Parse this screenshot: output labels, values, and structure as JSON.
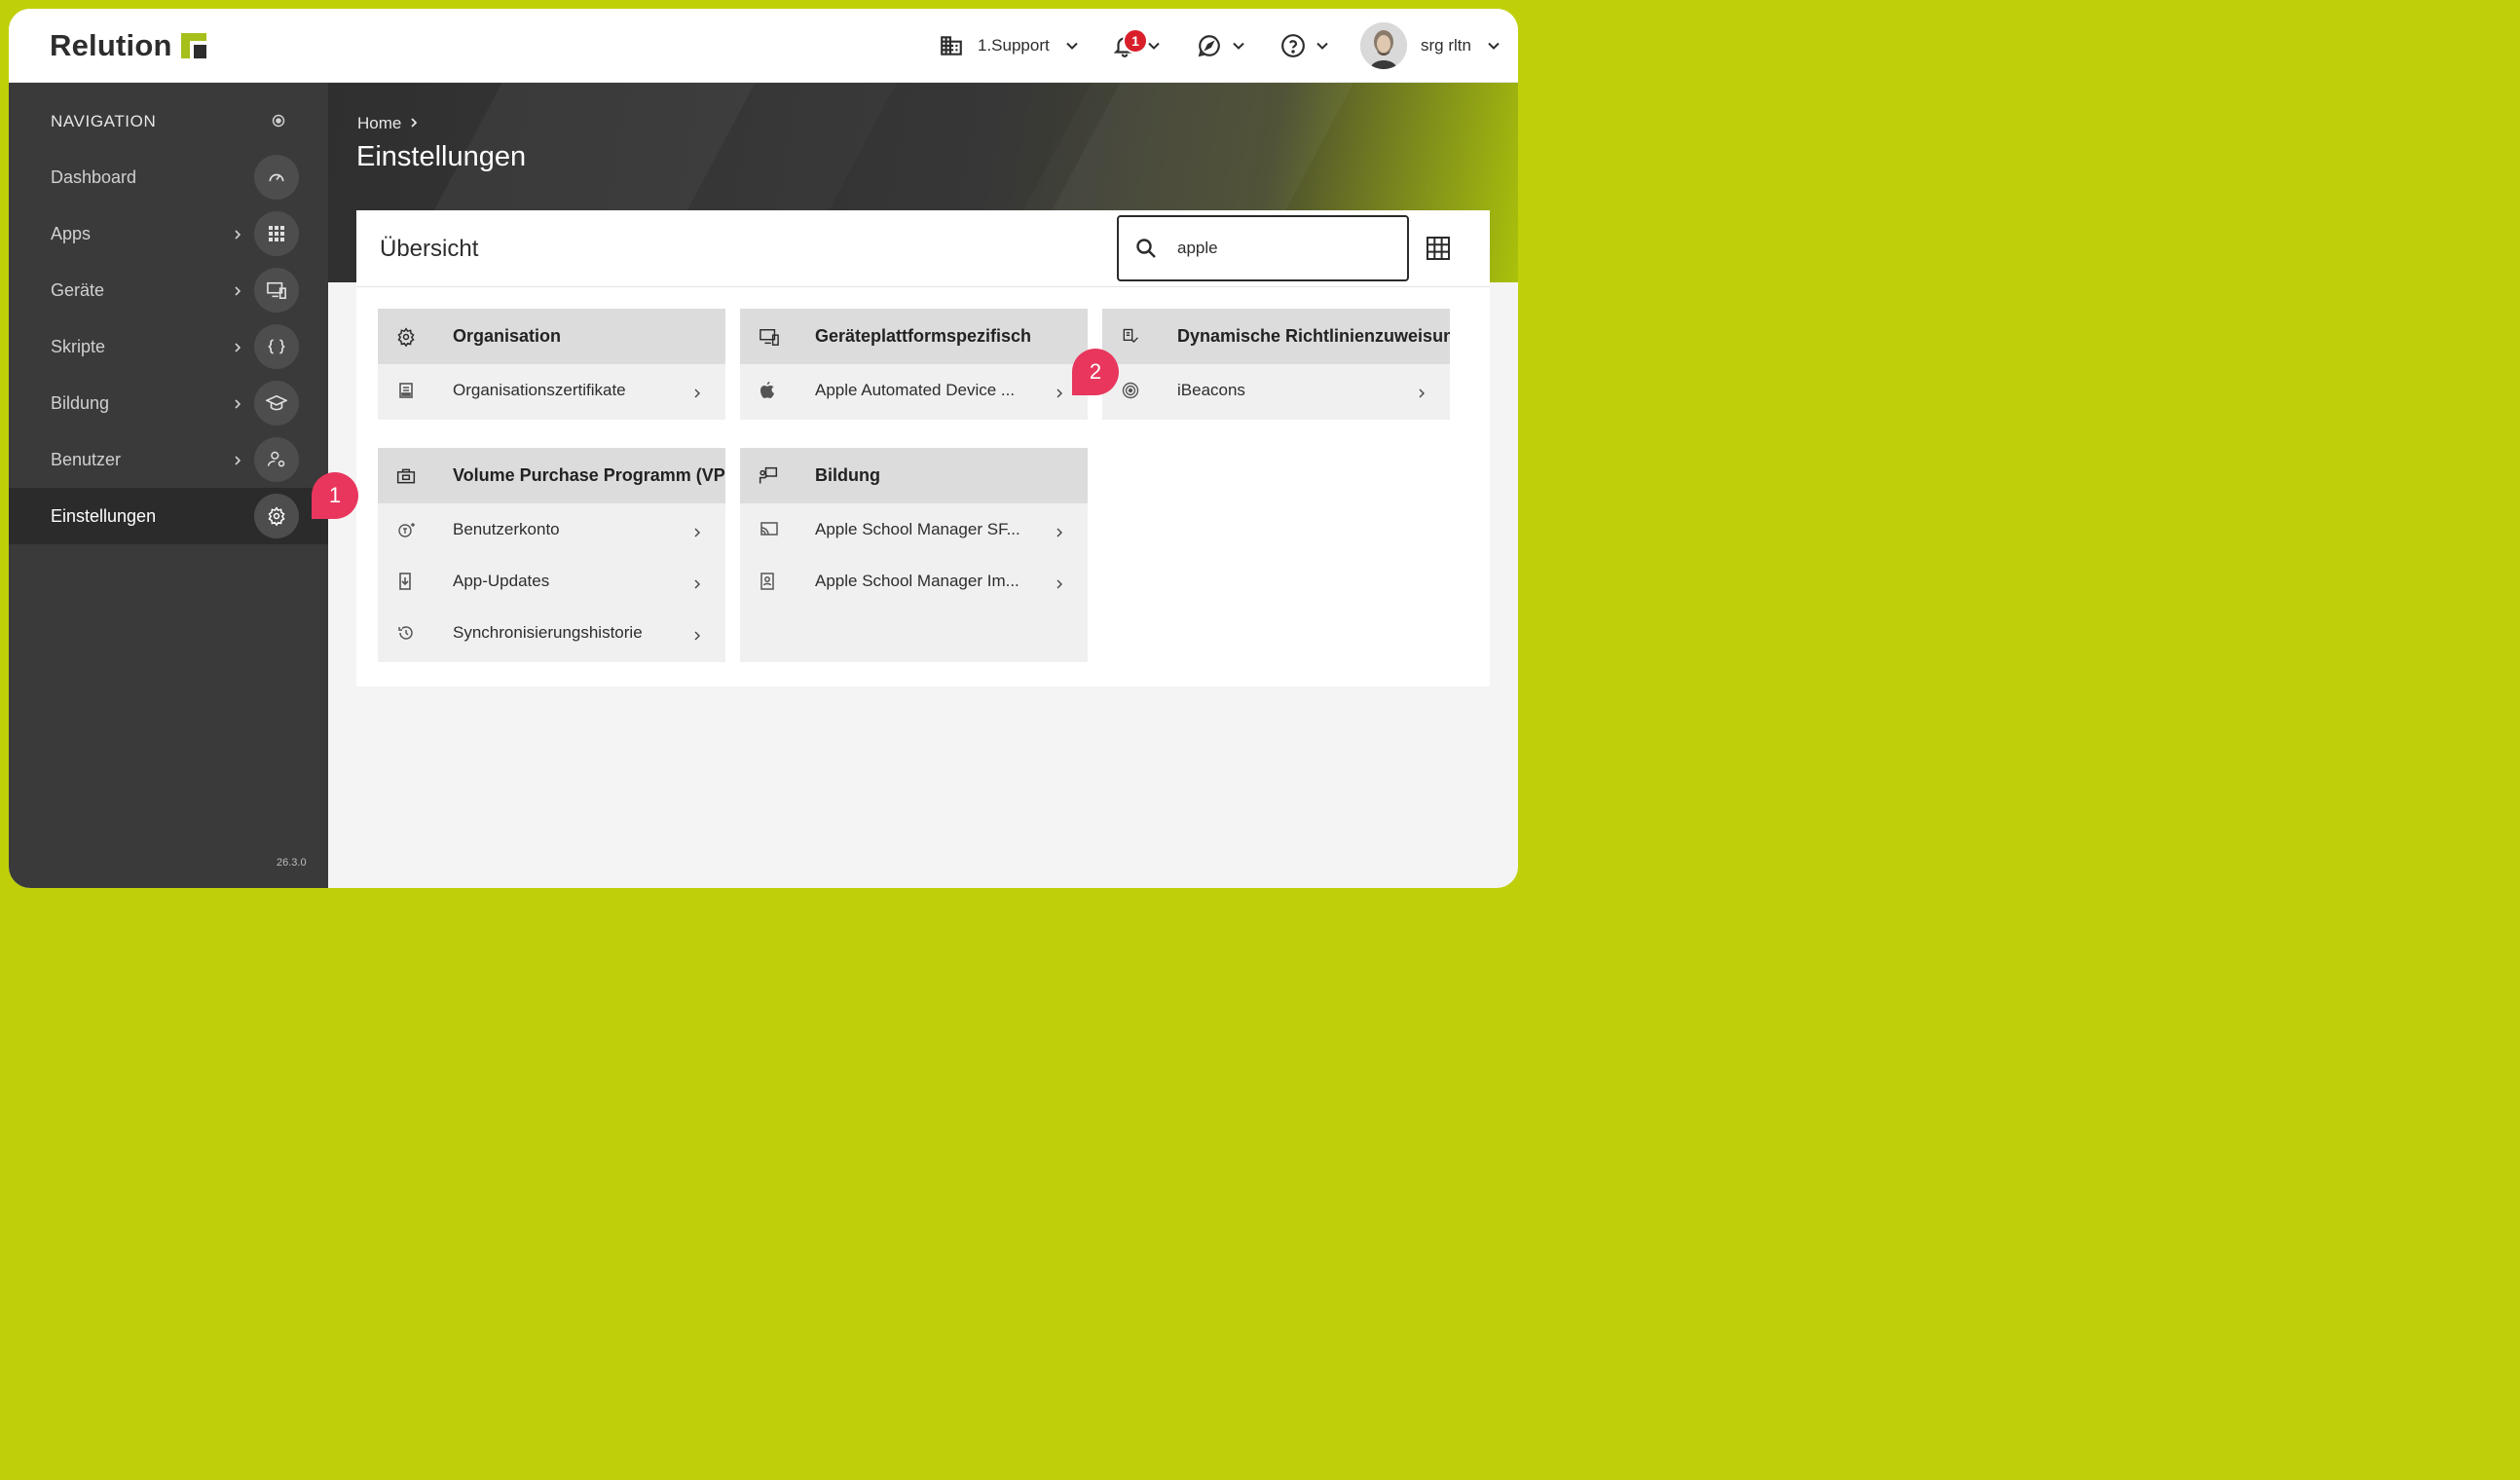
{
  "app": {
    "name": "Relution",
    "version": "26.3.0"
  },
  "topbar": {
    "organization": "1.Support",
    "notification_count": "1",
    "user_name": "srg rltn"
  },
  "navigation": {
    "heading": "NAVIGATION",
    "items": [
      {
        "label": "Dashboard",
        "icon": "speedometer-icon",
        "has_submenu": false,
        "active": false
      },
      {
        "label": "Apps",
        "icon": "apps-grid-icon",
        "has_submenu": true,
        "active": false
      },
      {
        "label": "Geräte",
        "icon": "devices-icon",
        "has_submenu": true,
        "active": false
      },
      {
        "label": "Skripte",
        "icon": "code-braces-icon",
        "has_submenu": true,
        "active": false
      },
      {
        "label": "Bildung",
        "icon": "graduation-cap-icon",
        "has_submenu": true,
        "active": false
      },
      {
        "label": "Benutzer",
        "icon": "user-settings-icon",
        "has_submenu": true,
        "active": false
      },
      {
        "label": "Einstellungen",
        "icon": "gear-icon",
        "has_submenu": false,
        "active": true
      }
    ]
  },
  "breadcrumb": {
    "home": "Home"
  },
  "page": {
    "title": "Einstellungen"
  },
  "overview": {
    "title": "Übersicht",
    "search_value": "apple",
    "groups": [
      {
        "title": "Organisation",
        "icon": "gear-icon",
        "items": [
          {
            "label": "Organisationszertifikate",
            "icon": "certificate-icon"
          }
        ]
      },
      {
        "title": "Geräteplattformspezifisch",
        "icon": "device-platform-icon",
        "items": [
          {
            "label": "Apple Automated Device ...",
            "icon": "apple-icon"
          }
        ]
      },
      {
        "title": "Dynamische Richtlinienzuweisung",
        "icon": "policy-assign-icon",
        "items": [
          {
            "label": "iBeacons",
            "icon": "beacon-icon"
          }
        ]
      },
      {
        "title": "Volume Purchase Programm (VPP)",
        "icon": "briefcase-icon",
        "items": [
          {
            "label": "Benutzerkonto",
            "icon": "account-token-icon"
          },
          {
            "label": "App-Updates",
            "icon": "app-update-icon"
          },
          {
            "label": "Synchronisierungshistorie",
            "icon": "history-icon"
          }
        ]
      },
      {
        "title": "Bildung",
        "icon": "classroom-icon",
        "items": [
          {
            "label": "Apple School Manager SF...",
            "icon": "cast-icon"
          },
          {
            "label": "Apple School Manager Im...",
            "icon": "import-icon"
          }
        ]
      }
    ]
  },
  "annotations": {
    "marker_1": "1",
    "marker_2": "2"
  },
  "colors": {
    "brand_green": "#bfd00a",
    "sidebar": "#3a3a3a",
    "sidebar_active": "#2b2b2b",
    "badge_red": "#d81f2a",
    "marker_pink": "#e8365d"
  }
}
